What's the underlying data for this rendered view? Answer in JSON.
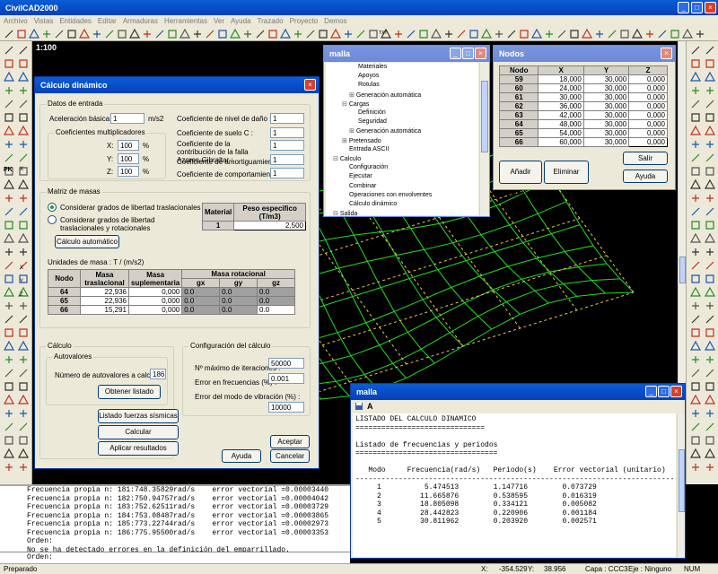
{
  "app": {
    "title": "CivilCAD2000",
    "menu": [
      "Archivo",
      "Vistas",
      "Entidades",
      "Editar",
      "Armaduras",
      "Herramientas",
      "Ver",
      "Ayuda",
      "Trazado",
      "Proyecto",
      "Demos"
    ],
    "scale_label": "1:100",
    "pk_label": "PK",
    "text_tool_label": "TXT",
    "axis_labels": {
      "x": "X",
      "y": "Y",
      "z": "Z"
    }
  },
  "calc_dialog": {
    "title": "Cálculo dinámico",
    "datos_entrada": "Datos de entrada",
    "aceleracion_label": "Aceleración básica :",
    "aceleracion_value": "1",
    "aceleracion_unit": "m/s2",
    "coef_mult_label": "Coeficientes multiplicadores",
    "coef_x_label": "X:",
    "coef_x_value": "100",
    "coef_y_label": "Y:",
    "coef_y_value": "100",
    "coef_z_label": "Z:",
    "coef_z_value": "100",
    "pct": "%",
    "nivel_dano_label": "Coeficiente de nivel de daño :",
    "nivel_dano_value": "1",
    "suelo_label": "Coeficiente de suelo C :",
    "suelo_value": "1",
    "falla_label": "Coeficiente de la contribución de la falla Azores-Gibraltar :",
    "falla_value": "1",
    "amort_label": "Coeficiente de amortiguamiento :",
    "amort_value": "1",
    "comport_label": "Coeficiente de comportamiento :",
    "comport_value": "1",
    "matriz_label": "Matriz de masas",
    "radio1": "Considerar grados de libertad traslacionales",
    "radio2": "Considerar grados de libertad traslacionales y rotacionales",
    "calc_auto_btn": "Cálculo automático",
    "material_headers": [
      "Material",
      "Peso específico (T/m3)"
    ],
    "material_rows": [
      [
        "1",
        "2,500"
      ]
    ],
    "unidades_label": "Unidades de masa : T / (m/s2)",
    "mass_headers": [
      "Nodo",
      "Masa traslacional",
      "Masa suplementaria",
      "Masa rotacional"
    ],
    "mass_subheaders": [
      "gx",
      "gy",
      "gz"
    ],
    "mass_rows": [
      [
        "64",
        "22,936",
        "0,000",
        "0.0",
        "0.0",
        "0.0"
      ],
      [
        "65",
        "22,936",
        "0,000",
        "0.0",
        "0.0",
        "0.0"
      ],
      [
        "66",
        "15,291",
        "0,000",
        "0.0",
        "0.0",
        "0.0"
      ]
    ],
    "calculo_label": "Cálculo",
    "autovalores_label": "Autovalores",
    "num_autoval_label": "Número de autovalores a calcular :",
    "num_autoval_value": "186",
    "obtener_btn": "Obtener listado",
    "listado_btn": "Listado fuerzas sísmicas",
    "calcular_btn": "Calcular",
    "aplicar_btn": "Aplicar resultados",
    "config_label": "Configuración del cálculo",
    "max_iter_label": "Nº máximo de iteraciones :",
    "max_iter_value": "50000",
    "err_frec_label": "Error en frecuencias (%) :",
    "err_frec_value": "0.001",
    "err_modo_label": "Error del modo de vibración (%) :",
    "err_modo_value": "10000",
    "aceptar_btn": "Aceptar",
    "ayuda_btn": "Ayuda",
    "cancelar_btn": "Cancelar"
  },
  "tree_window": {
    "title": "malla",
    "items": [
      "Materiales",
      "Apoyos",
      "Rotulas",
      "Generación automática",
      "Cargas",
      "Definición",
      "Seguridad",
      "Generación automática",
      "Pretensado",
      "Entrada ASCII",
      "Calculo",
      "Configuración",
      "Ejecutar",
      "Combinar",
      "Operaciones con envolventes",
      "Cálculo dinámico",
      "Salida"
    ]
  },
  "nodos_window": {
    "title": "Nodos",
    "headers": [
      "Nodo",
      "X",
      "Y",
      "Z"
    ],
    "rows": [
      [
        "59",
        "18,000",
        "30,000",
        "0,000"
      ],
      [
        "60",
        "24,000",
        "30,000",
        "0,000"
      ],
      [
        "61",
        "30,000",
        "30,000",
        "0,000"
      ],
      [
        "62",
        "36,000",
        "30,000",
        "0,000"
      ],
      [
        "63",
        "42,000",
        "30,000",
        "0,000"
      ],
      [
        "64",
        "48,000",
        "30,000",
        "0,000"
      ],
      [
        "65",
        "54,000",
        "30,000",
        "0,000"
      ],
      [
        "66",
        "60,000",
        "30,000",
        "0,000"
      ]
    ],
    "anadir_btn": "Añadir nodos",
    "eliminar_btn": "Eliminar nodos",
    "salir_btn": "Salir",
    "ayuda_btn": "Ayuda"
  },
  "listing_window": {
    "title": "malla",
    "font_icon": "A",
    "line1": "LISTADO DEL CALCULO DINAMICO",
    "rule1": "==============================",
    "line2": "Listado de frecuencias y periodos",
    "rule2": "=================================",
    "col_headers": "   Modo     Frecuencia(rad/s)   Periodo(s)    Error vectorial (unitario)",
    "rule3": "--------------------------------------------------------------------------",
    "rows": [
      "     1          5.474513        1.147716        0.073729",
      "     2         11.665876        0.538595        0.016319",
      "     3         18.805098        0.334121        0.005082",
      "     4         28.442823        0.220906        0.001184",
      "     5         30.811962        0.203920        0.002571"
    ]
  },
  "console": {
    "lines": [
      "Frecuencia propia n: 181:748.35829rad/s    error vectorial =0.00003440",
      "Frecuencia propia n: 182:750.94757rad/s    error vectorial =0.00004042",
      "Frecuencia propia n: 183:752.62511rad/s    error vectorial =0.00003729",
      "Frecuencia propia n: 184:753.08487rad/s    error vectorial =0.00003865",
      "Frecuencia propia n: 185:773.22744rad/s    error vectorial =0.00002973",
      "Frecuencia propia n: 186:775.95500rad/s    error vectorial =0.00003353",
      "Orden:",
      "No se ha detectado errores en la definición del emparrillado.",
      "Orden:"
    ],
    "prompt": "Orden:"
  },
  "status": {
    "left": "Preparado",
    "x_label": "X:",
    "x_value": "-354.529",
    "y_label": "Y:",
    "y_value": "38.956",
    "capa": "Capa : CCC3",
    "eje": "Eje : Ninguno",
    "num": "NUM"
  },
  "colors": {
    "mesh": "#22dd22",
    "mesh_dashed": "#e6c84a",
    "titlebar": "#0a5cd6",
    "canvas": "#000000"
  }
}
